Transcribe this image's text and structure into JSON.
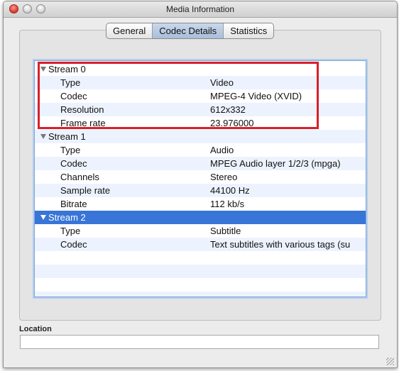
{
  "window": {
    "title": "Media Information"
  },
  "tabs": [
    {
      "label": "General"
    },
    {
      "label": "Codec Details"
    },
    {
      "label": "Statistics"
    }
  ],
  "streams": [
    {
      "label": "Stream 0",
      "props": [
        {
          "key": "Type",
          "value": "Video"
        },
        {
          "key": "Codec",
          "value": "MPEG-4 Video (XVID)"
        },
        {
          "key": "Resolution",
          "value": "612x332"
        },
        {
          "key": "Frame rate",
          "value": "23.976000"
        }
      ]
    },
    {
      "label": "Stream 1",
      "props": [
        {
          "key": "Type",
          "value": "Audio"
        },
        {
          "key": "Codec",
          "value": "MPEG Audio layer 1/2/3 (mpga)"
        },
        {
          "key": "Channels",
          "value": "Stereo"
        },
        {
          "key": "Sample rate",
          "value": "44100 Hz"
        },
        {
          "key": "Bitrate",
          "value": "112 kb/s"
        }
      ]
    },
    {
      "label": "Stream 2",
      "props": [
        {
          "key": "Type",
          "value": "Subtitle"
        },
        {
          "key": "Codec",
          "value": "Text subtitles with various tags (su"
        }
      ]
    }
  ],
  "location": {
    "label": "Location",
    "value": ""
  },
  "colors": {
    "selection": "#3875d7",
    "highlight_box": "#d8202a"
  }
}
